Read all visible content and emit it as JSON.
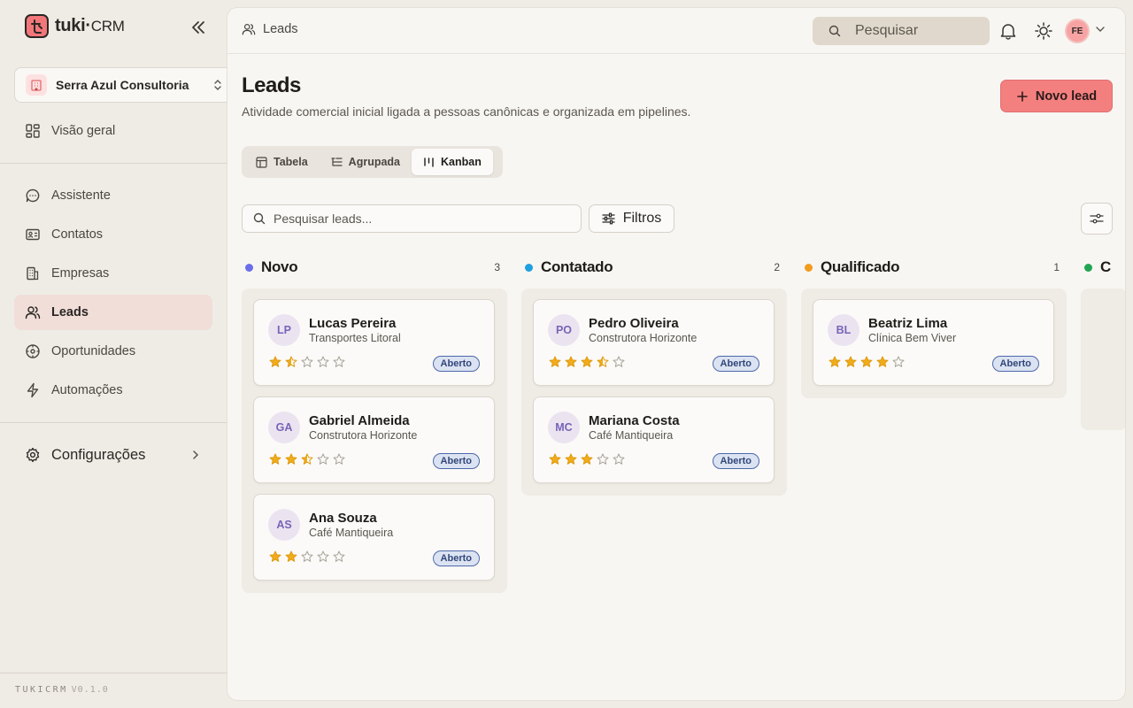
{
  "brand": {
    "name": "tuki",
    "suffix": "CRM",
    "footer": "TUKICRM",
    "version": "V0.1.0"
  },
  "org": {
    "name": "Serra Azul Consultoria"
  },
  "nav": {
    "overview": "Visão geral",
    "assistant": "Assistente",
    "contacts": "Contatos",
    "companies": "Empresas",
    "leads": "Leads",
    "opportunities": "Oportunidades",
    "automations": "Automações",
    "settings": "Configurações"
  },
  "header": {
    "breadcrumb": "Leads",
    "search_placeholder": "Pesquisar",
    "avatar_initials": "FE"
  },
  "page": {
    "title": "Leads",
    "subtitle": "Atividade comercial inicial ligada a pessoas canônicas e organizada em pipelines.",
    "new_lead_label": "Novo lead"
  },
  "views": {
    "table": "Tabela",
    "grouped": "Agrupada",
    "kanban": "Kanban",
    "active": "Kanban"
  },
  "toolbar": {
    "search_placeholder": "Pesquisar leads...",
    "filters_label": "Filtros"
  },
  "kanban": {
    "columns": [
      {
        "name": "Novo",
        "count": "3",
        "color": "#6a6ee8",
        "cards": [
          {
            "initials": "LP",
            "name": "Lucas Pereira",
            "company": "Transportes Litoral",
            "rating": 1.5,
            "status": "Aberto"
          },
          {
            "initials": "GA",
            "name": "Gabriel Almeida",
            "company": "Construtora Horizonte",
            "rating": 2.5,
            "status": "Aberto"
          },
          {
            "initials": "AS",
            "name": "Ana Souza",
            "company": "Café Mantiqueira",
            "rating": 2,
            "status": "Aberto"
          }
        ]
      },
      {
        "name": "Contatado",
        "count": "2",
        "color": "#1fa0e0",
        "cards": [
          {
            "initials": "PO",
            "name": "Pedro Oliveira",
            "company": "Construtora Horizonte",
            "rating": 3.5,
            "status": "Aberto"
          },
          {
            "initials": "MC",
            "name": "Mariana Costa",
            "company": "Café Mantiqueira",
            "rating": 3,
            "status": "Aberto"
          }
        ]
      },
      {
        "name": "Qualificado",
        "count": "1",
        "color": "#f29c1f",
        "cards": [
          {
            "initials": "BL",
            "name": "Beatriz Lima",
            "company": "Clínica Bem Viver",
            "rating": 4,
            "status": "Aberto"
          }
        ]
      },
      {
        "name": "C",
        "count": "",
        "color": "#22a552",
        "cards": []
      }
    ]
  }
}
